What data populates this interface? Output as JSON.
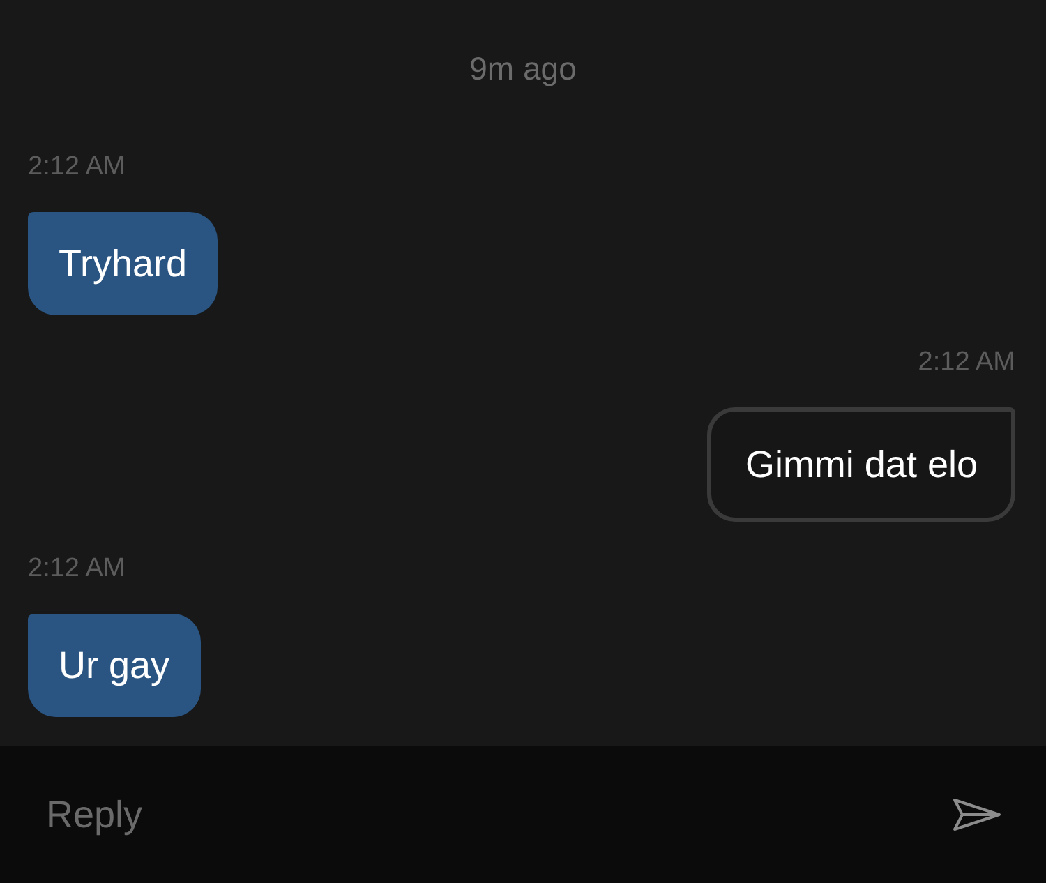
{
  "header": {
    "relative_time": "9m ago"
  },
  "messages": [
    {
      "kind": "incoming",
      "time": "2:12 AM",
      "text": "Tryhard"
    },
    {
      "kind": "outgoing",
      "time": "2:12 AM",
      "text": "Gimmi dat elo"
    },
    {
      "kind": "incoming",
      "time": "2:12 AM",
      "text": "Ur gay"
    }
  ],
  "composer": {
    "placeholder": "Reply"
  }
}
